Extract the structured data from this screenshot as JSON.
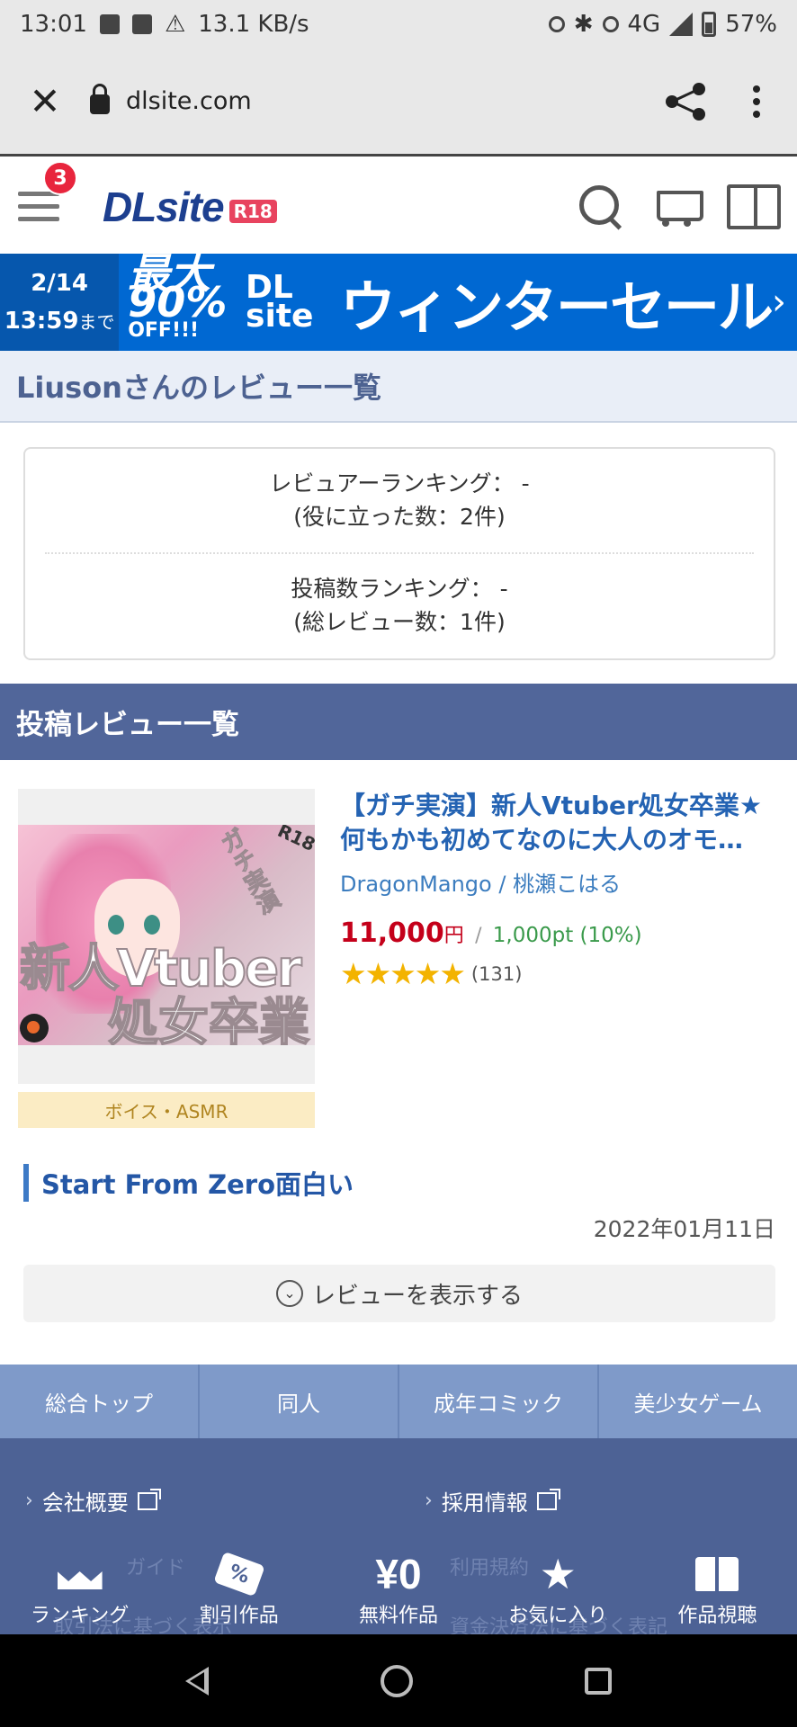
{
  "status_bar": {
    "time": "13:01",
    "net_speed": "13.1 KB/s",
    "network": "4G",
    "battery": "57%"
  },
  "browser": {
    "url": "dlsite.com",
    "close_icon": "close-icon",
    "share_icon": "share-icon",
    "menu_icon": "more-vert-icon"
  },
  "header": {
    "notification_count": "3",
    "logo_text": "DLsite",
    "logo_badge": "R18"
  },
  "sale_banner": {
    "date": "2/14",
    "time": "13:59",
    "until": "まで",
    "discount_line1": "最大90%",
    "discount_line2": "OFF!!!",
    "brand": "DL site",
    "title": "ウィンターセール"
  },
  "page_title": "Liusonさんのレビュー一覧",
  "ranking": {
    "reviewer_rank": "レビュアーランキング： -",
    "helpful_count": "(役に立った数：2件)",
    "post_rank": "投稿数ランキング： -",
    "total_reviews": "(総レビュー数：1件)"
  },
  "section_title": "投稿レビュー一覧",
  "product": {
    "title": "【ガチ実演】新人Vtuber処女卒業★何もかも初めてなのに大人のオモ…",
    "circle": "DragonMango",
    "separator": " / ",
    "voice_actor": "桃瀬こはる",
    "price": "11,000",
    "price_unit": "円",
    "price_sep": "/",
    "points": "1,000pt (10%)",
    "rating_stars": 5,
    "stars_text": "★★★★★",
    "rating_count": "(131)",
    "category": "ボイス・ASMR",
    "thumb_text_1": "新人Vtuber",
    "thumb_text_2": "処女卒業",
    "thumb_text_3": "ガチ実演",
    "thumb_r18": "R18"
  },
  "review": {
    "title": "Start From Zero面白い",
    "date": "2022年01月11日",
    "toggle_label": "レビューを表示する"
  },
  "category_nav": [
    "総合トップ",
    "同人",
    "成年コミック",
    "美少女ゲーム"
  ],
  "footer": {
    "company": "会社概要",
    "recruit": "採用情報",
    "ghost_1": "ガイド",
    "ghost_2": "利用規約",
    "ghost_3": "取引法に基づく表示",
    "ghost_4": "資金決済法に基づく表記"
  },
  "bottom_nav": [
    {
      "label": "ランキング",
      "icon": "crown-icon"
    },
    {
      "label": "割引作品",
      "icon": "discount-tag-icon"
    },
    {
      "label": "無料作品",
      "icon": "yen-zero-icon"
    },
    {
      "label": "お気に入り",
      "icon": "star-icon"
    },
    {
      "label": "作品視聴",
      "icon": "book-icon"
    }
  ],
  "colors": {
    "brand_blue": "#1d3f8f",
    "sale_blue": "#0068d2",
    "section_bar": "#51669a",
    "footer": "#4d6295",
    "price_red": "#c4001a",
    "points_green": "#3a9a4b",
    "star_gold": "#f3b300"
  }
}
